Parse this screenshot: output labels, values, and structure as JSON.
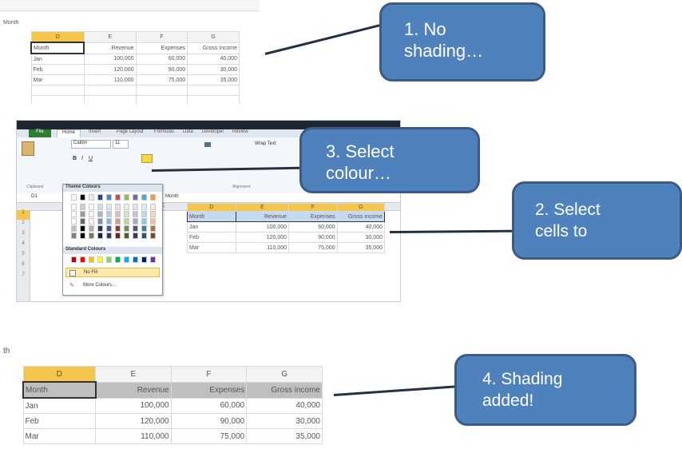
{
  "step1": {
    "formula_bar_text": "Month",
    "columns": [
      "D",
      "E",
      "F",
      "G"
    ],
    "headers": [
      "Month",
      "Revenue",
      "Expenses",
      "Gross income"
    ],
    "rows": [
      [
        "Jan",
        "100,000",
        "60,000",
        "40,000"
      ],
      [
        "Feb",
        "120,000",
        "90,000",
        "30,000"
      ],
      [
        "Mar",
        "110,000",
        "75,000",
        "35,000"
      ]
    ]
  },
  "step2": {
    "ribbon_tabs": [
      "File",
      "Home",
      "Insert",
      "Page Layout",
      "Formulas",
      "Data",
      "Developer",
      "Review"
    ],
    "font_name": "Calibri",
    "font_size": "11",
    "wrap_text": "Wrap Text",
    "clipboard_label": "Clipboard",
    "alignment_label": "Alignment",
    "name_box": "D1",
    "formula_bar_text": "Month",
    "dropdown": {
      "theme_colours_label": "Theme Colours",
      "standard_colours_label": "Standard Colours",
      "no_fill_label": "No Fill",
      "more_colours_label": "More Colours..."
    },
    "columns": [
      "C",
      "D",
      "E",
      "F",
      "G"
    ],
    "row_numbers": [
      "1",
      "2",
      "3",
      "4",
      "5",
      "6",
      "7"
    ],
    "headers": [
      "Month",
      "Revenue",
      "Expenses",
      "Gross income"
    ],
    "rows": [
      [
        "Jan",
        "100,000",
        "60,000",
        "40,000"
      ],
      [
        "Feb",
        "120,000",
        "90,000",
        "30,000"
      ],
      [
        "Mar",
        "110,000",
        "75,000",
        "35,000"
      ]
    ],
    "theme_colors": [
      "#ffffff",
      "#000000",
      "#eeece1",
      "#1f497d",
      "#4f81bd",
      "#c0504d",
      "#9bbb59",
      "#8064a2",
      "#4bacc6",
      "#f79646"
    ],
    "standard_colors": [
      "#c00000",
      "#ff0000",
      "#ffc000",
      "#ffff00",
      "#92d050",
      "#00b050",
      "#00b0f0",
      "#0070c0",
      "#002060",
      "#7030a0"
    ]
  },
  "step4": {
    "formula_bar_text": "th",
    "columns": [
      "D",
      "E",
      "F",
      "G"
    ],
    "headers": [
      "Month",
      "Revenue",
      "Expenses",
      "Gross income"
    ],
    "rows": [
      [
        "Jan",
        "100,000",
        "60,000",
        "40,000"
      ],
      [
        "Feb",
        "120,000",
        "90,000",
        "30,000"
      ],
      [
        "Mar",
        "110,000",
        "75,000",
        "35,000"
      ]
    ]
  },
  "callouts": {
    "step1": {
      "line1": "1. No",
      "line2": "shading…"
    },
    "step3": {
      "line1": "3. Select",
      "line2": "colour…"
    },
    "step2": {
      "line1": "2. Select",
      "line2": "cells to"
    },
    "step4": {
      "line1": "4. Shading",
      "line2": "added!"
    }
  },
  "colors": {
    "callout_fill": "#4f81bd",
    "callout_border": "#3b5b85",
    "selected_column_header": "#f4c54c",
    "shading_blue": "#c6d9f1",
    "shading_gray": "#bfbfbf"
  }
}
